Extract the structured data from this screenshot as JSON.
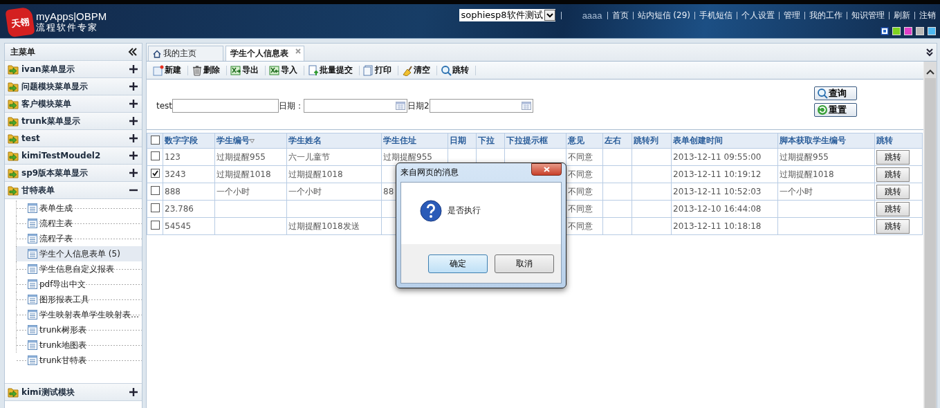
{
  "header": {
    "logo_mark": "天翎",
    "logo_title": "myApps|OBPM",
    "logo_subtitle": "流程软件专家",
    "workspace_select": {
      "value": "sophiesp8软件测试"
    },
    "user": "aaaa",
    "nav_links": [
      "首页",
      "站内短信 (29)",
      "手机短信",
      "个人设置",
      "管理",
      "我的工作",
      "知识管理",
      "刷新",
      "注销"
    ],
    "theme_swatches": [
      {
        "color": "#2f6cc9",
        "selected": true
      },
      {
        "color": "#7ed321",
        "selected": false
      },
      {
        "color": "#e040c8",
        "selected": false
      },
      {
        "color": "#b8b8b8",
        "selected": false
      },
      {
        "color": "#4fb8f0",
        "selected": false
      }
    ]
  },
  "sidebar": {
    "title": "主菜单",
    "menus": [
      {
        "label": "ivan菜单显示",
        "expanded": false
      },
      {
        "label": "问题模块菜单显示",
        "expanded": false
      },
      {
        "label": "客户模块菜单",
        "expanded": false
      },
      {
        "label": "trunk菜单显示",
        "expanded": false
      },
      {
        "label": "test",
        "expanded": false
      },
      {
        "label": "kimiTestMoudel2",
        "expanded": false
      },
      {
        "label": "sp9版本菜单显示",
        "expanded": false
      },
      {
        "label": "甘特表单",
        "expanded": true,
        "children": [
          {
            "label": "表单生成",
            "selected": false
          },
          {
            "label": "流程主表",
            "selected": false
          },
          {
            "label": "流程子表",
            "selected": false
          },
          {
            "label": "学生个人信息表单 (5)",
            "selected": true
          },
          {
            "label": "学生信息自定义报表",
            "selected": false
          },
          {
            "label": "pdf导出中文",
            "selected": false
          },
          {
            "label": "图形报表工具",
            "selected": false
          },
          {
            "label": "学生映射表单学生映射表…",
            "selected": false
          },
          {
            "label": "trunk树形表",
            "selected": false
          },
          {
            "label": "trunk地图表",
            "selected": false
          },
          {
            "label": "trunk甘特表",
            "selected": false
          }
        ]
      },
      {
        "label": "kimi测试模块",
        "expanded": false
      }
    ]
  },
  "tabs": [
    {
      "label": "我的主页",
      "kind": "home",
      "selected": false
    },
    {
      "label": "学生个人信息表",
      "kind": "page",
      "selected": true
    }
  ],
  "toolbar": [
    {
      "label": "新建",
      "kind": "new"
    },
    {
      "label": "删除",
      "kind": "delete"
    },
    {
      "label": "导出",
      "kind": "export"
    },
    {
      "label": "导入",
      "kind": "import"
    },
    {
      "label": "批量提交",
      "kind": "submit"
    },
    {
      "label": "打印",
      "kind": "print"
    },
    {
      "label": "清空",
      "kind": "clear"
    },
    {
      "label": "跳转",
      "kind": "jump"
    }
  ],
  "search": {
    "fields": [
      {
        "label": "test",
        "kind": "text"
      },
      {
        "label": "日期：",
        "kind": "date"
      },
      {
        "label": "日期2",
        "kind": "date"
      }
    ],
    "buttons": [
      {
        "label": "查询",
        "kind": "query"
      },
      {
        "label": "重置",
        "kind": "reset"
      }
    ]
  },
  "table": {
    "select_all_checked": false,
    "columns": [
      {
        "label": "数字字段",
        "sorted": false
      },
      {
        "label": "学生编号",
        "sorted": true
      },
      {
        "label": "学生姓名",
        "sorted": false
      },
      {
        "label": "学生住址",
        "sorted": false
      },
      {
        "label": "日期",
        "sorted": false
      },
      {
        "label": "下拉",
        "sorted": false
      },
      {
        "label": "下拉提示框",
        "sorted": false
      },
      {
        "label": "意见",
        "sorted": false
      },
      {
        "label": "左右",
        "sorted": false
      },
      {
        "label": "跳转列",
        "sorted": false
      },
      {
        "label": "表单创建时间",
        "sorted": false
      },
      {
        "label": "脚本获取学生编号",
        "sorted": false
      },
      {
        "label": "跳转",
        "sorted": false
      }
    ],
    "rows": [
      {
        "checked": false,
        "cells": [
          "123",
          "过期提醒955",
          "六一儿童节",
          "过期提醒955",
          null,
          null,
          null,
          "不同意",
          null,
          null,
          "2013-12-11 09:55:00",
          "过期提醒955",
          "跳转"
        ]
      },
      {
        "checked": true,
        "cells": [
          "3243",
          "过期提醒1018",
          "过期提醒1018",
          null,
          null,
          null,
          null,
          "不同意",
          null,
          null,
          "2013-12-11 10:19:12",
          "过期提醒1018",
          "跳转"
        ]
      },
      {
        "checked": false,
        "cells": [
          "888",
          "一个小时",
          "一个小时",
          "88",
          null,
          null,
          null,
          "不同意",
          null,
          null,
          "2013-12-11 10:52:03",
          "一个小时",
          "跳转"
        ]
      },
      {
        "checked": false,
        "cells": [
          "23.786",
          null,
          null,
          null,
          null,
          null,
          null,
          "不同意",
          null,
          null,
          "2013-12-10 16:44:08",
          null,
          "跳转"
        ]
      },
      {
        "checked": false,
        "cells": [
          "54545",
          null,
          "过期提醒1018发送",
          null,
          null,
          null,
          null,
          "不同意",
          null,
          null,
          "2013-12-11 10:18:18",
          null,
          "跳转"
        ]
      }
    ]
  },
  "dialog": {
    "title": "来自网页的消息",
    "message": "是否执行",
    "buttons": [
      {
        "label": "确定",
        "default": true
      },
      {
        "label": "取消",
        "default": false
      }
    ]
  }
}
